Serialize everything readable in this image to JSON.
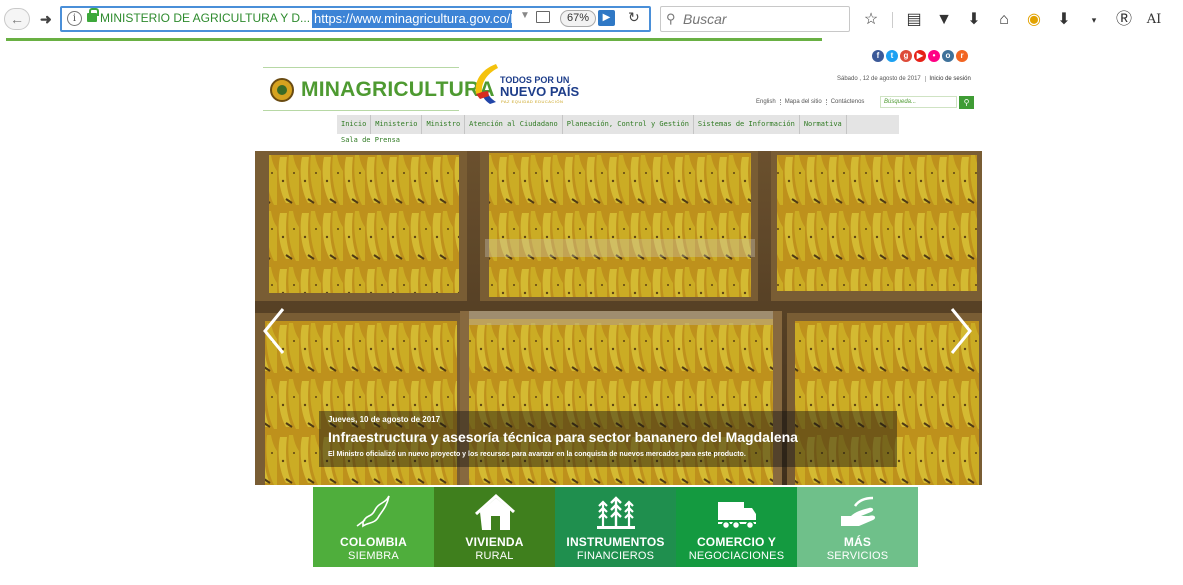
{
  "browser": {
    "site_identity": "MINISTERIO DE AGRICULTURA Y D... (CO)",
    "url": "https://www.minagricultura.gov.co/Pa",
    "zoom": "67%",
    "search_placeholder": "Buscar",
    "account_label": "AI"
  },
  "site": {
    "logo_text": "MINAGRICULTURA",
    "gov_brand_line1": "TODOS POR UN",
    "gov_brand_line2": "NUEVO PAÍS",
    "gov_brand_line3": "PAZ   EQUIDAD   EDUCACIÓN",
    "date_text": "Sábado , 12 de agosto de 2017",
    "login_link": "Inicio de sesión",
    "util_links": [
      "English",
      "Mapa del sitio",
      "Contáctenos"
    ],
    "search_placeholder": "Búsqueda...",
    "menu": [
      "Inicio",
      "Ministerio",
      "Ministro",
      "Atención al Ciudadano",
      "Planeación, Control y Gestión",
      "Sistemas de Información",
      "Normativa"
    ],
    "menu_second_row": "Sala de Prensa",
    "social_colors": [
      "#3b5998",
      "#1da1f2",
      "#dd4b39",
      "#e62117",
      "#ff0084",
      "#3f729b",
      "#f26522"
    ]
  },
  "slider": {
    "date": "Jueves, 10 de agosto de 2017",
    "title": "Infraestructura y asesoría técnica para sector bananero del Magdalena",
    "subtitle": "El Ministro oficializó un nuevo proyecto y los recursos para avanzar en la conquista de nuevos mercados para este producto."
  },
  "tiles": [
    {
      "line1": "COLOMBIA",
      "line2": "SIEMBRA",
      "color": "#4fae3c"
    },
    {
      "line1": "VIVIENDA",
      "line2": "RURAL",
      "color": "#3f7f1d"
    },
    {
      "line1": "INSTRUMENTOS",
      "line2": "FINANCIEROS",
      "color": "#1f8f4e"
    },
    {
      "line1": "COMERCIO Y",
      "line2": "NEGOCIACIONES",
      "color": "#149a40"
    },
    {
      "line1": "MÁS",
      "line2": "SERVICIOS",
      "color": "#6fc08a"
    }
  ]
}
